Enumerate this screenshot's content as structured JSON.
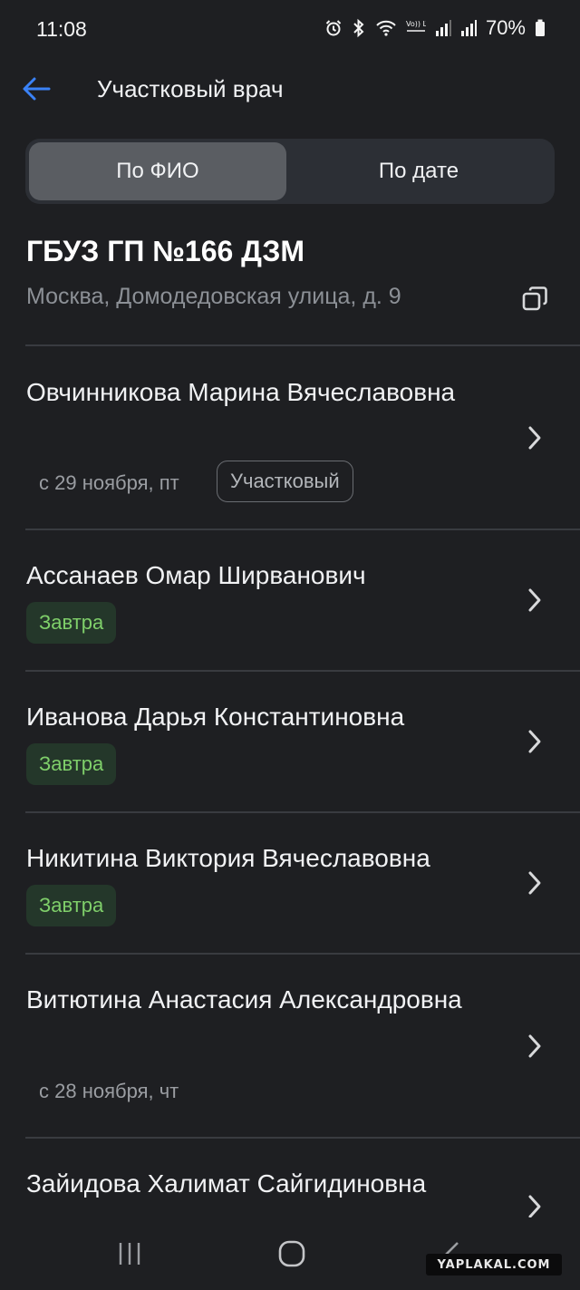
{
  "status_bar": {
    "time": "11:08",
    "battery_percent": "70%",
    "volte_label": "Vo)) LTE1",
    "icons": [
      "alarm-icon",
      "bluetooth-icon",
      "wifi-icon",
      "volte-icon",
      "signal-icon",
      "signal-icon",
      "battery-icon"
    ]
  },
  "app_bar": {
    "title": "Участковый врач",
    "back_icon": "arrow-left-icon"
  },
  "segmented": {
    "tabs": [
      "По ФИО",
      "По дате"
    ],
    "selected_index": 0
  },
  "clinic": {
    "name": "ГБУЗ ГП №166 ДЗМ",
    "address": "Москва, Домодедовская улица, д. 9",
    "copy_icon": "copy-icon"
  },
  "doctors": [
    {
      "name": "Овчинникова Марина Вячеславовна",
      "date": "с 29 ноября, пт",
      "tag": "Участковый"
    },
    {
      "name": "Ассанаев Омар Ширванович",
      "badge": "Завтра"
    },
    {
      "name": "Иванова Дарья Константиновна",
      "badge": "Завтра"
    },
    {
      "name": "Никитина Виктория Вячеславовна",
      "badge": "Завтра"
    },
    {
      "name": "Витютина Анастасия Александровна",
      "date": "с 28 ноября, чт"
    },
    {
      "name": "Зайидова Халимат Сайгидиновна"
    }
  ],
  "nav_bar": {
    "icons": [
      "recent-apps-icon",
      "home-icon",
      "back-icon"
    ]
  },
  "watermark": "YAPLAKAL.COM",
  "colors": {
    "background": "#1e1f22",
    "accent": "#3a82f7",
    "badge_green": "#7fcf6a"
  }
}
